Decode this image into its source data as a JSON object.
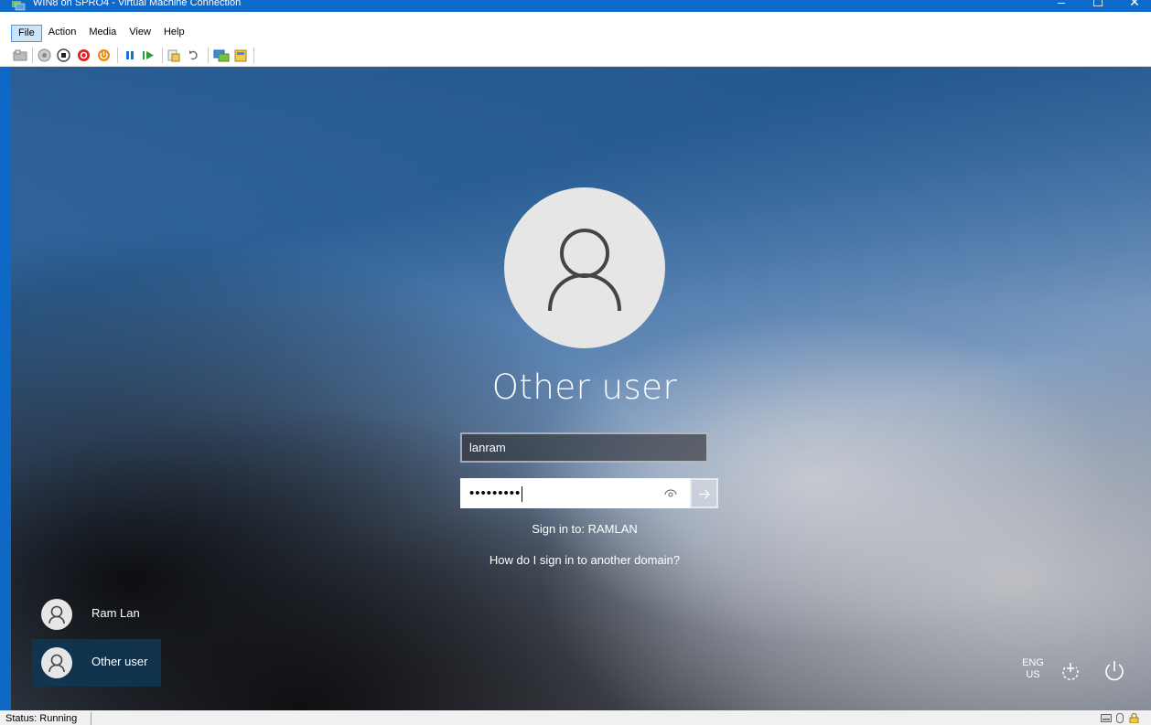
{
  "window": {
    "title": "WIN8 on SPRO4 - Virtual Machine Connection",
    "minimize_glyph": "–",
    "maximize_glyph": "☐",
    "close_glyph": "✕"
  },
  "menu": {
    "items": [
      "File",
      "Action",
      "Media",
      "View",
      "Help"
    ]
  },
  "toolbar": {
    "icons": [
      "ctrl-alt-del-icon",
      "start-icon",
      "turn-off-icon",
      "shutdown-icon",
      "save-icon",
      "pause-icon",
      "reset-icon",
      "checkpoint-icon",
      "revert-icon",
      "enhanced-session-icon",
      "share-icon"
    ]
  },
  "login": {
    "display_name": "Other user",
    "username_value": "lanram",
    "password_mask": "•••••••••",
    "sign_in_to": "Sign in to: RAMLAN",
    "domain_help_link": "How do I sign in to another domain?"
  },
  "user_list": [
    {
      "name": "Ram Lan",
      "selected": false
    },
    {
      "name": "Other user",
      "selected": true
    }
  ],
  "system_tray": {
    "lang_primary": "ENG",
    "lang_secondary": "US"
  },
  "status": {
    "text": "Status: Running"
  },
  "colors": {
    "titlebar": "#0e69c9",
    "selected_tile": "#0f3755"
  }
}
